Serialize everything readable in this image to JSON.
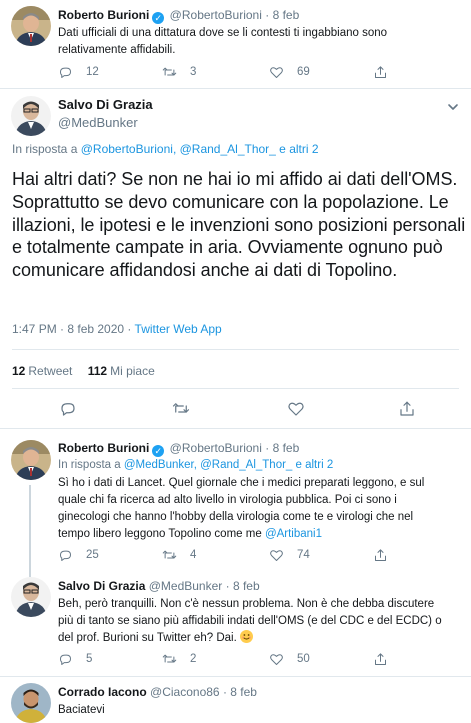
{
  "tweets": {
    "t1": {
      "name": "Roberto Burioni",
      "handle": "@RobertoBurioni",
      "dot": "·",
      "date": "8 feb",
      "text_line1": "Dati ufficiali di una dittatura dove se li contesti ti ingabbiano sono",
      "text_line2": "relativamente affidabili.",
      "replies": "12",
      "retweets": "3",
      "likes": "69"
    },
    "main": {
      "name": "Salvo Di Grazia",
      "handle": "@MedBunker",
      "reply_prefix": "In risposta a",
      "reply_links": "@RobertoBurioni, @Rand_Al_Thor_ e altri 2",
      "text": "Hai altri dati? Se non ne hai io mi affido ai dati dell'OMS. Soprattutto se devo comunicare con la popolazione. Le illazioni, le ipotesi e le invenzioni sono posizioni personali e totalmente campate in aria. Ovviamente ognuno può comunicare affidandosi anche ai dati di Topolino.",
      "time": "1:47 PM · 8 feb 2020 ·",
      "source": "Twitter Web App",
      "retweet_count": "12",
      "retweet_label": "Retweet",
      "like_count": "112",
      "like_label": "Mi piace"
    },
    "t3": {
      "name": "Roberto Burioni",
      "handle": "@RobertoBurioni",
      "dot": "·",
      "date": "8 feb",
      "reply_prefix": "In risposta a",
      "reply_links": "@MedBunker, @Rand_Al_Thor_ e altri 2",
      "line1": "Sì ho i dati di Lancet. Quel giornale che i medici preparati leggono, e sul",
      "line2": "quale chi fa ricerca ad alto livello in virologia pubblica. Poi ci sono i",
      "line3": "ginecologi che hanno l'hobby della virologia come te e virologi che nel",
      "line4": "tempo libero leggono Topolino come me",
      "mention": "@Artibani1",
      "replies": "25",
      "retweets": "4",
      "likes": "74"
    },
    "t4": {
      "name": "Salvo Di Grazia",
      "handle": "@MedBunker",
      "dot": "·",
      "date": "8 feb",
      "line1": "Beh, però tranquilli. Non c'è nessun problema. Non è che debba discutere",
      "line2": "più di tanto se siano più affidabili indati dell'OMS (e del CDC e del ECDC) o",
      "line3": "del prof. Burioni su Twitter eh? Dai.",
      "emoji": "smiling-face",
      "replies": "5",
      "retweets": "2",
      "likes": "50"
    },
    "t5": {
      "name": "Corrado Iacono",
      "handle": "@Ciacono86",
      "dot": "·",
      "date": "8 feb",
      "text": "Baciatevi"
    }
  },
  "colors": {
    "link": "#1b95e0",
    "muted": "#657786",
    "text": "#14171a",
    "verified": "#1da1f2",
    "divider": "#e1e8ed"
  }
}
